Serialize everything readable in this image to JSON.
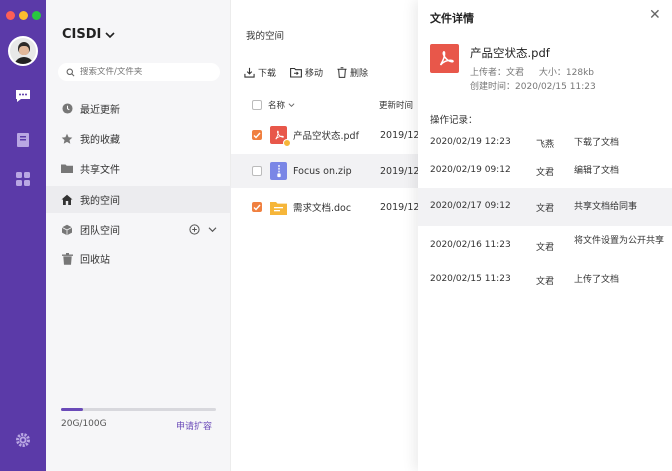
{
  "colors": {
    "rail": "#5b3aa8",
    "accent": "#6a4ab8",
    "pdf": "#e8574a",
    "zip": "#7a86e6",
    "folder": "#f6b63a",
    "check": "#f08040"
  },
  "rail": {
    "icons": [
      "chat-icon",
      "notebook-icon",
      "apps-icon",
      "settings-icon"
    ]
  },
  "sidebar": {
    "team_name": "CISDI",
    "search_placeholder": "搜索文件/文件夹",
    "items": [
      {
        "label": "最近更新",
        "icon": "clock-icon"
      },
      {
        "label": "我的收藏",
        "icon": "star-icon"
      },
      {
        "label": "共享文件",
        "icon": "folder-icon"
      },
      {
        "label": "我的空间",
        "icon": "home-icon"
      },
      {
        "label": "团队空间",
        "icon": "cube-icon"
      },
      {
        "label": "回收站",
        "icon": "trash-icon"
      }
    ],
    "storage": {
      "used_fraction": 0.14,
      "text": "20G/100G",
      "expand_label": "申请扩容"
    }
  },
  "main": {
    "breadcrumb": "我的空间",
    "toolbar": {
      "download": "下载",
      "move": "移动",
      "delete": "删除"
    },
    "columns": {
      "name": "名称",
      "updated": "更新时间"
    },
    "files": [
      {
        "name": "产品空状态.pdf",
        "updated": "2019/12",
        "checked": true,
        "type": "pdf"
      },
      {
        "name": "Focus on.zip",
        "updated": "2019/12",
        "checked": false,
        "type": "zip"
      },
      {
        "name": "需求文档.doc",
        "updated": "2019/12",
        "checked": true,
        "type": "folder"
      }
    ]
  },
  "panel": {
    "title": "文件详情",
    "close": "✕",
    "doc_name": "产品空状态.pdf",
    "uploader_label": "上传者：",
    "uploader": "文君",
    "size_label": "大小：",
    "size": "128kb",
    "created_label": "创建时间：",
    "created": "2020/02/15 11:23",
    "log_title": "操作记录：",
    "logs": [
      {
        "time": "2020/02/19 12:23",
        "user": "飞燕",
        "action": "下载了文档"
      },
      {
        "time": "2020/02/19 09:12",
        "user": "文君",
        "action": "编辑了文档"
      },
      {
        "time": "2020/02/17 09:12",
        "user": "文君",
        "action": "共享文档给同事"
      },
      {
        "time": "2020/02/16 11:23",
        "user": "文君",
        "action": "将文件设置为公开共享"
      },
      {
        "time": "2020/02/15 11:23",
        "user": "文君",
        "action": "上传了文档"
      }
    ]
  }
}
